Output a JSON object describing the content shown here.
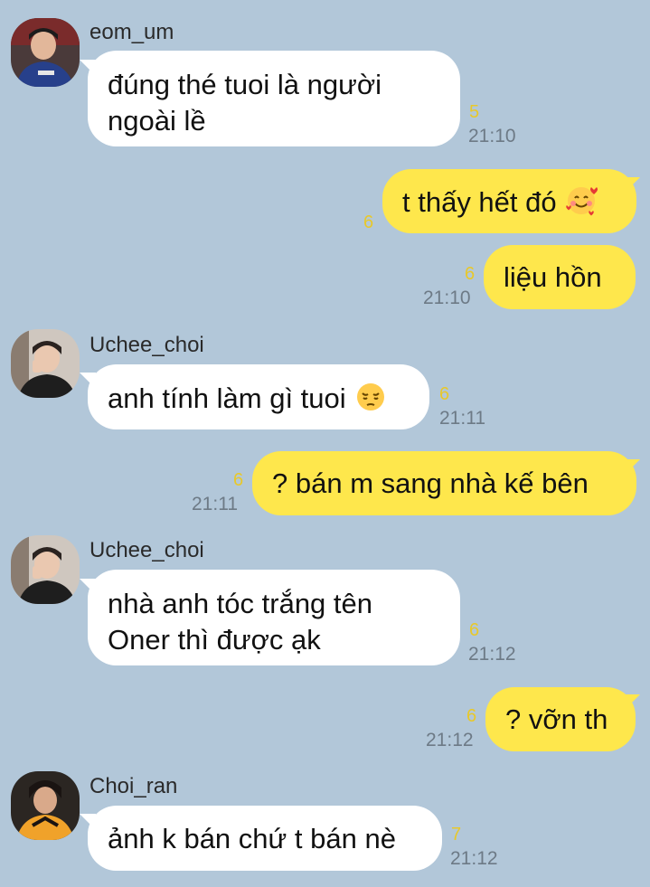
{
  "messages": [
    {
      "sender": "eom_um",
      "text_lines": [
        "đúng thé tuoi là người",
        "ngoài lề"
      ],
      "unread": "5",
      "time": "21:10",
      "avatar_icon": "avatar-eom-um-icon"
    },
    {
      "sender": "me",
      "text": "t thấy hết đó",
      "emoji": "smiling-face-with-hearts-icon",
      "unread": "6",
      "time": ""
    },
    {
      "sender": "me",
      "text": "liệu hồn",
      "unread": "6",
      "time": "21:10"
    },
    {
      "sender": "Uchee_choi",
      "text": "anh tính làm gì tuoi",
      "emoji": "pensive-face-icon",
      "unread": "6",
      "time": "21:11",
      "avatar_icon": "avatar-uchee-choi-icon"
    },
    {
      "sender": "me",
      "text": "? bán m sang nhà kế bên",
      "unread": "6",
      "time": "21:11"
    },
    {
      "sender": "Uchee_choi",
      "text_lines": [
        "nhà anh tóc trắng tên",
        "Oner thì được ạk"
      ],
      "unread": "6",
      "time": "21:12",
      "avatar_icon": "avatar-uchee-choi-icon"
    },
    {
      "sender": "me",
      "text": "? vỡn th",
      "unread": "6",
      "time": "21:12"
    },
    {
      "sender": "Choi_ran",
      "text": "ảnh k bán chứ t bán nè",
      "unread": "7",
      "time": "21:12",
      "avatar_icon": "avatar-choi-ran-icon"
    }
  ],
  "colors": {
    "background": "#b2c7d9",
    "incoming_bubble": "#ffffff",
    "outgoing_bubble": "#fee74c",
    "unread_count": "#e8c82a",
    "timestamp": "#6d7a86"
  }
}
